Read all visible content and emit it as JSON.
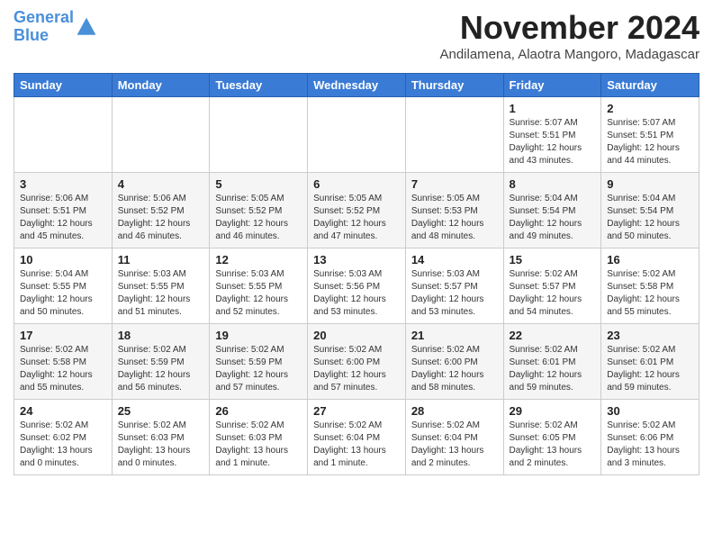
{
  "header": {
    "logo_line1": "General",
    "logo_line2": "Blue",
    "month_title": "November 2024",
    "location": "Andilamena, Alaotra Mangoro, Madagascar"
  },
  "weekdays": [
    "Sunday",
    "Monday",
    "Tuesday",
    "Wednesday",
    "Thursday",
    "Friday",
    "Saturday"
  ],
  "weeks": [
    [
      {
        "day": "",
        "info": ""
      },
      {
        "day": "",
        "info": ""
      },
      {
        "day": "",
        "info": ""
      },
      {
        "day": "",
        "info": ""
      },
      {
        "day": "",
        "info": ""
      },
      {
        "day": "1",
        "info": "Sunrise: 5:07 AM\nSunset: 5:51 PM\nDaylight: 12 hours\nand 43 minutes."
      },
      {
        "day": "2",
        "info": "Sunrise: 5:07 AM\nSunset: 5:51 PM\nDaylight: 12 hours\nand 44 minutes."
      }
    ],
    [
      {
        "day": "3",
        "info": "Sunrise: 5:06 AM\nSunset: 5:51 PM\nDaylight: 12 hours\nand 45 minutes."
      },
      {
        "day": "4",
        "info": "Sunrise: 5:06 AM\nSunset: 5:52 PM\nDaylight: 12 hours\nand 46 minutes."
      },
      {
        "day": "5",
        "info": "Sunrise: 5:05 AM\nSunset: 5:52 PM\nDaylight: 12 hours\nand 46 minutes."
      },
      {
        "day": "6",
        "info": "Sunrise: 5:05 AM\nSunset: 5:52 PM\nDaylight: 12 hours\nand 47 minutes."
      },
      {
        "day": "7",
        "info": "Sunrise: 5:05 AM\nSunset: 5:53 PM\nDaylight: 12 hours\nand 48 minutes."
      },
      {
        "day": "8",
        "info": "Sunrise: 5:04 AM\nSunset: 5:54 PM\nDaylight: 12 hours\nand 49 minutes."
      },
      {
        "day": "9",
        "info": "Sunrise: 5:04 AM\nSunset: 5:54 PM\nDaylight: 12 hours\nand 50 minutes."
      }
    ],
    [
      {
        "day": "10",
        "info": "Sunrise: 5:04 AM\nSunset: 5:55 PM\nDaylight: 12 hours\nand 50 minutes."
      },
      {
        "day": "11",
        "info": "Sunrise: 5:03 AM\nSunset: 5:55 PM\nDaylight: 12 hours\nand 51 minutes."
      },
      {
        "day": "12",
        "info": "Sunrise: 5:03 AM\nSunset: 5:55 PM\nDaylight: 12 hours\nand 52 minutes."
      },
      {
        "day": "13",
        "info": "Sunrise: 5:03 AM\nSunset: 5:56 PM\nDaylight: 12 hours\nand 53 minutes."
      },
      {
        "day": "14",
        "info": "Sunrise: 5:03 AM\nSunset: 5:57 PM\nDaylight: 12 hours\nand 53 minutes."
      },
      {
        "day": "15",
        "info": "Sunrise: 5:02 AM\nSunset: 5:57 PM\nDaylight: 12 hours\nand 54 minutes."
      },
      {
        "day": "16",
        "info": "Sunrise: 5:02 AM\nSunset: 5:58 PM\nDaylight: 12 hours\nand 55 minutes."
      }
    ],
    [
      {
        "day": "17",
        "info": "Sunrise: 5:02 AM\nSunset: 5:58 PM\nDaylight: 12 hours\nand 55 minutes."
      },
      {
        "day": "18",
        "info": "Sunrise: 5:02 AM\nSunset: 5:59 PM\nDaylight: 12 hours\nand 56 minutes."
      },
      {
        "day": "19",
        "info": "Sunrise: 5:02 AM\nSunset: 5:59 PM\nDaylight: 12 hours\nand 57 minutes."
      },
      {
        "day": "20",
        "info": "Sunrise: 5:02 AM\nSunset: 6:00 PM\nDaylight: 12 hours\nand 57 minutes."
      },
      {
        "day": "21",
        "info": "Sunrise: 5:02 AM\nSunset: 6:00 PM\nDaylight: 12 hours\nand 58 minutes."
      },
      {
        "day": "22",
        "info": "Sunrise: 5:02 AM\nSunset: 6:01 PM\nDaylight: 12 hours\nand 59 minutes."
      },
      {
        "day": "23",
        "info": "Sunrise: 5:02 AM\nSunset: 6:01 PM\nDaylight: 12 hours\nand 59 minutes."
      }
    ],
    [
      {
        "day": "24",
        "info": "Sunrise: 5:02 AM\nSunset: 6:02 PM\nDaylight: 13 hours\nand 0 minutes."
      },
      {
        "day": "25",
        "info": "Sunrise: 5:02 AM\nSunset: 6:03 PM\nDaylight: 13 hours\nand 0 minutes."
      },
      {
        "day": "26",
        "info": "Sunrise: 5:02 AM\nSunset: 6:03 PM\nDaylight: 13 hours\nand 1 minute."
      },
      {
        "day": "27",
        "info": "Sunrise: 5:02 AM\nSunset: 6:04 PM\nDaylight: 13 hours\nand 1 minute."
      },
      {
        "day": "28",
        "info": "Sunrise: 5:02 AM\nSunset: 6:04 PM\nDaylight: 13 hours\nand 2 minutes."
      },
      {
        "day": "29",
        "info": "Sunrise: 5:02 AM\nSunset: 6:05 PM\nDaylight: 13 hours\nand 2 minutes."
      },
      {
        "day": "30",
        "info": "Sunrise: 5:02 AM\nSunset: 6:06 PM\nDaylight: 13 hours\nand 3 minutes."
      }
    ]
  ]
}
